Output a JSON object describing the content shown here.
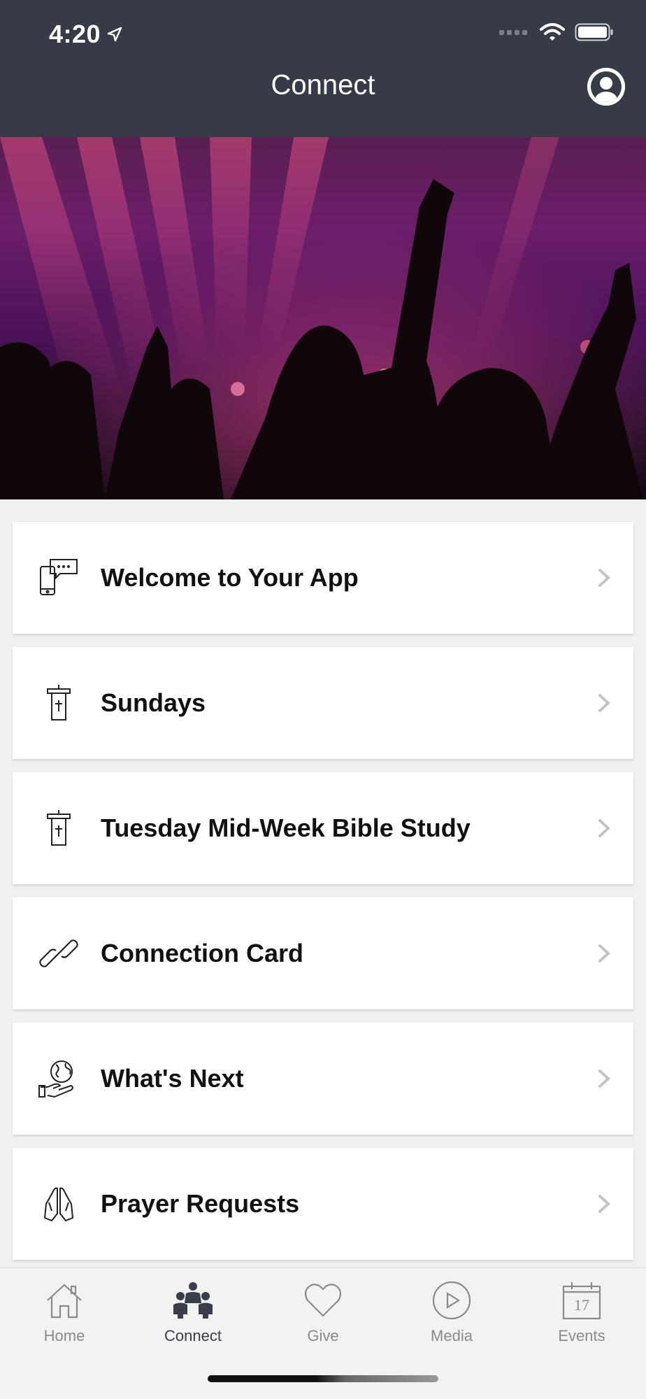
{
  "status_bar": {
    "time": "4:20"
  },
  "header": {
    "title": "Connect"
  },
  "list": [
    {
      "label": "Welcome to Your App",
      "icon": "chat-phone-icon"
    },
    {
      "label": "Sundays",
      "icon": "pulpit-icon"
    },
    {
      "label": "Tuesday Mid-Week Bible Study",
      "icon": "pulpit-icon"
    },
    {
      "label": "Connection Card",
      "icon": "link-icon"
    },
    {
      "label": "What's Next",
      "icon": "globe-hand-icon"
    },
    {
      "label": "Prayer Requests",
      "icon": "praying-hands-icon"
    }
  ],
  "tabs": [
    {
      "label": "Home",
      "icon": "home-icon",
      "active": false
    },
    {
      "label": "Connect",
      "icon": "people-icon",
      "active": true
    },
    {
      "label": "Give",
      "icon": "heart-icon",
      "active": false
    },
    {
      "label": "Media",
      "icon": "play-icon",
      "active": false
    },
    {
      "label": "Events",
      "icon": "calendar-icon",
      "active": false,
      "calendar_day": "17"
    }
  ],
  "colors": {
    "header_bg": "#373b48",
    "active_tab": "#3a3d4a",
    "inactive_tab": "#8a8a8a"
  }
}
